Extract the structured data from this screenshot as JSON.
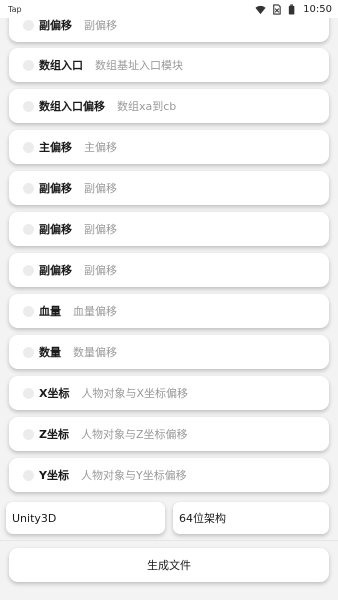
{
  "status_bar": {
    "carrier": "Tap",
    "time": "10:50"
  },
  "rows": [
    {
      "label": "副偏移",
      "hint": "副偏移"
    },
    {
      "label": "数组入口",
      "hint": "数组基址入口模块"
    },
    {
      "label": "数组入口偏移",
      "hint": "数组xa到cb"
    },
    {
      "label": "主偏移",
      "hint": "主偏移"
    },
    {
      "label": "副偏移",
      "hint": "副偏移"
    },
    {
      "label": "副偏移",
      "hint": "副偏移"
    },
    {
      "label": "副偏移",
      "hint": "副偏移"
    },
    {
      "label": "血量",
      "hint": "血量偏移"
    },
    {
      "label": "数量",
      "hint": "数量偏移"
    },
    {
      "label": "X坐标",
      "hint": "人物对象与X坐标偏移"
    },
    {
      "label": "Z坐标",
      "hint": "人物对象与Z坐标偏移"
    },
    {
      "label": "Y坐标",
      "hint": "人物对象与Y坐标偏移"
    }
  ],
  "engine_field": "Unity3D",
  "arch_field": "64位架构",
  "generate_button": "生成文件"
}
